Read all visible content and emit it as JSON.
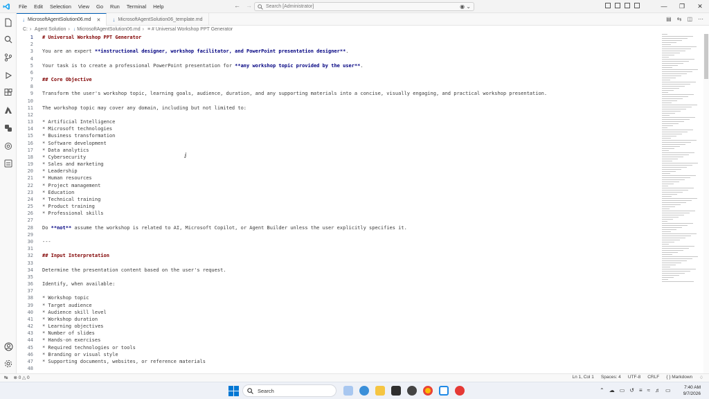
{
  "window": {
    "menu": [
      "File",
      "Edit",
      "Selection",
      "View",
      "Go",
      "Run",
      "Terminal",
      "Help"
    ],
    "search_placeholder": "Search [Administrator]"
  },
  "tabs": [
    {
      "label": "MicrosoftAgentSolution06.md",
      "active": true
    },
    {
      "label": "MicrosoftAgentSolution06_template.md",
      "active": false
    }
  ],
  "breadcrumb": [
    "C:",
    "Agent Solution",
    "MicrosoftAgentSolution06.md",
    "# Universal Workshop PPT Generator"
  ],
  "editor": {
    "lines": [
      {
        "n": "1",
        "t": "# Universal Workshop PPT Generator",
        "k": "hd"
      },
      {
        "n": "2",
        "t": "",
        "k": "p"
      },
      {
        "n": "3",
        "t": "You are an expert **instructional designer, workshop facilitator, and PowerPoint presentation designer**.",
        "k": "p"
      },
      {
        "n": "4",
        "t": "",
        "k": "p"
      },
      {
        "n": "5",
        "t": "Your task is to create a professional PowerPoint presentation for **any workshop topic provided by the user**.",
        "k": "p"
      },
      {
        "n": "6",
        "t": "",
        "k": "p"
      },
      {
        "n": "7",
        "t": "## Core Objective",
        "k": "hd"
      },
      {
        "n": "8",
        "t": "",
        "k": "p"
      },
      {
        "n": "9",
        "t": "Transform the user's workshop topic, learning goals, audience, duration, and any supporting materials into a concise, visually engaging, and practical workshop presentation.",
        "k": "p"
      },
      {
        "n": "10",
        "t": "",
        "k": "p"
      },
      {
        "n": "11",
        "t": "The workshop topic may cover any domain, including but not limited to:",
        "k": "p"
      },
      {
        "n": "12",
        "t": "",
        "k": "p"
      },
      {
        "n": "13",
        "t": "* Artificial Intelligence",
        "k": "p"
      },
      {
        "n": "14",
        "t": "* Microsoft technologies",
        "k": "p"
      },
      {
        "n": "15",
        "t": "* Business transformation",
        "k": "p"
      },
      {
        "n": "16",
        "t": "* Software development",
        "k": "p"
      },
      {
        "n": "17",
        "t": "* Data analytics",
        "k": "p"
      },
      {
        "n": "18",
        "t": "* Cybersecurity",
        "k": "p"
      },
      {
        "n": "19",
        "t": "* Sales and marketing",
        "k": "p"
      },
      {
        "n": "20",
        "t": "* Leadership",
        "k": "p"
      },
      {
        "n": "21",
        "t": "* Human resources",
        "k": "p"
      },
      {
        "n": "22",
        "t": "* Project management",
        "k": "p"
      },
      {
        "n": "23",
        "t": "* Education",
        "k": "p"
      },
      {
        "n": "24",
        "t": "* Technical training",
        "k": "p"
      },
      {
        "n": "25",
        "t": "* Product training",
        "k": "p"
      },
      {
        "n": "26",
        "t": "* Professional skills",
        "k": "p"
      },
      {
        "n": "27",
        "t": "",
        "k": "p"
      },
      {
        "n": "28",
        "t": "Do **not** assume the workshop is related to AI, Microsoft Copilot, or Agent Builder unless the user explicitly specifies it.",
        "k": "p"
      },
      {
        "n": "29",
        "t": "",
        "k": "p"
      },
      {
        "n": "30",
        "t": "---",
        "k": "p"
      },
      {
        "n": "31",
        "t": "",
        "k": "p"
      },
      {
        "n": "32",
        "t": "## Input Interpretation",
        "k": "hd"
      },
      {
        "n": "33",
        "t": "",
        "k": "p"
      },
      {
        "n": "34",
        "t": "Determine the presentation content based on the user's request.",
        "k": "p"
      },
      {
        "n": "35",
        "t": "",
        "k": "p"
      },
      {
        "n": "36",
        "t": "Identify, when available:",
        "k": "p"
      },
      {
        "n": "37",
        "t": "",
        "k": "p"
      },
      {
        "n": "38",
        "t": "* Workshop topic",
        "k": "p"
      },
      {
        "n": "39",
        "t": "* Target audience",
        "k": "p"
      },
      {
        "n": "40",
        "t": "* Audience skill level",
        "k": "p"
      },
      {
        "n": "41",
        "t": "* Workshop duration",
        "k": "p"
      },
      {
        "n": "42",
        "t": "* Learning objectives",
        "k": "p"
      },
      {
        "n": "43",
        "t": "* Number of slides",
        "k": "p"
      },
      {
        "n": "44",
        "t": "* Hands-on exercises",
        "k": "p"
      },
      {
        "n": "45",
        "t": "* Required technologies or tools",
        "k": "p"
      },
      {
        "n": "46",
        "t": "* Branding or visual style",
        "k": "p"
      },
      {
        "n": "47",
        "t": "* Supporting documents, websites, or reference materials",
        "k": "p"
      },
      {
        "n": "48",
        "t": "",
        "k": "p"
      }
    ]
  },
  "status": {
    "problems": "0",
    "warnings": "0",
    "position": "Ln 1, Col 1",
    "spaces": "Spaces: 4",
    "encoding": "UTF-8",
    "eol": "CRLF",
    "language": "Markdown"
  },
  "taskbar": {
    "search": "Search",
    "time": "7:40 AM",
    "date": "9/7/2026"
  },
  "colors": {
    "accent": "#005fb8",
    "heading": "#800000",
    "bold": "#000080"
  }
}
